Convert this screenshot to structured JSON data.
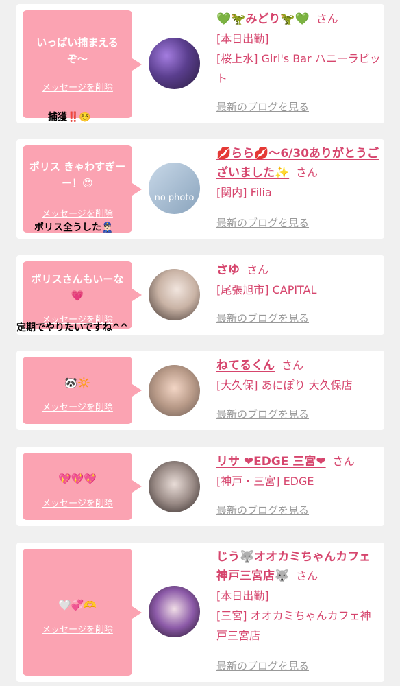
{
  "delete_label": "メッセージを削除",
  "blog_label": "最新のブログを見る",
  "san_label": "さん",
  "cards": [
    {
      "message": "いっぱい捕まえるぞ〜",
      "overlay": "捕獲‼️☺️",
      "name": "💚🦖みどり🦖💚",
      "lines": [
        "[本日出勤]",
        "[桜上水] Girl's Bar ハニーラビット"
      ]
    },
    {
      "message": "ポリス きゃわすぎーー！😍",
      "overlay": "ポリス全うした👮🏻‍♂️",
      "name": "💋らら💋〜6/30ありがとうございました✨",
      "lines": [
        "[関内] Filia"
      ],
      "avatar_text": "no photo"
    },
    {
      "message": "ポリスさんもいーな💗",
      "overlay": "定期でやりたいですね^^",
      "name": "さゆ",
      "lines": [
        "[尾張旭市] CAPITAL"
      ]
    },
    {
      "message": "🐼🔆",
      "name": "ねてるくん",
      "lines": [
        "[大久保] あにぽり 大久保店"
      ]
    },
    {
      "message": "💖💖💖",
      "name": "リサ ❤︎EDGE 三宮❤︎",
      "lines": [
        "[神戸・三宮] EDGE"
      ]
    },
    {
      "message": "🤍💞🫶",
      "name": "じう🐺オオカミちゃんカフェ神戸三宮店🐺",
      "lines": [
        "[本日出勤]",
        "[三宮] オオカミちゃんカフェ神戸三宮店"
      ]
    }
  ],
  "colors": {
    "bubble": "#fba3b2",
    "accent": "#d6456d",
    "muted": "#999999",
    "page_bg": "#f0f0f0"
  }
}
